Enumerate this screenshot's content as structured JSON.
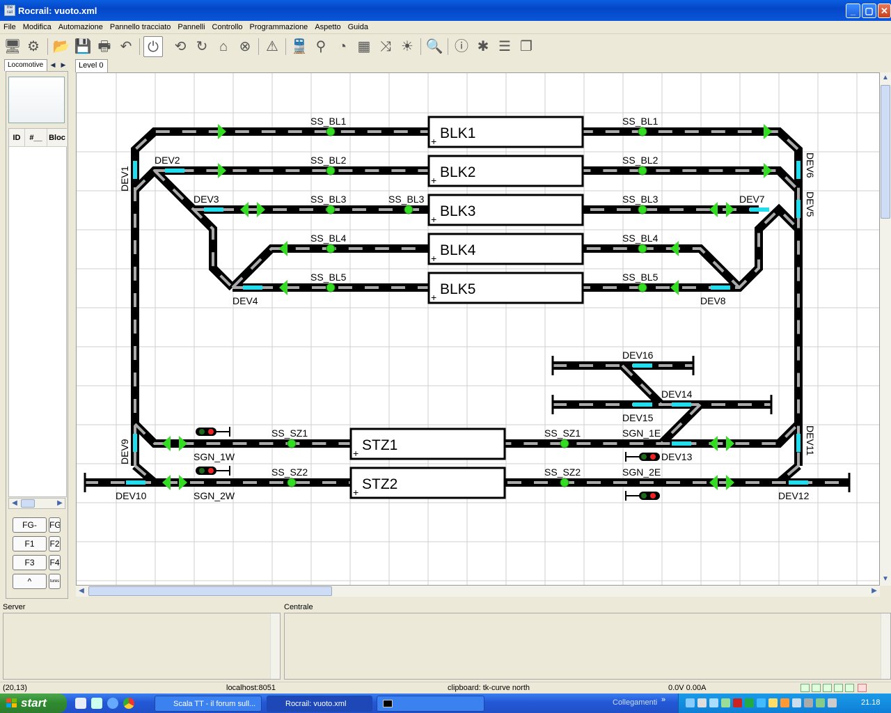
{
  "window": {
    "title": "Rocrail: vuoto.xml",
    "app_icon_text": "the rail"
  },
  "menu": [
    "File",
    "Modifica",
    "Automazione",
    "Pannello tracciato",
    "Pannelli",
    "Controllo",
    "Programmazione",
    "Aspetto",
    "Guida"
  ],
  "toolbar_icons": [
    "network-icon",
    "settings-icon",
    "open-icon",
    "save-icon",
    "print-icon",
    "undo-icon",
    "power-icon",
    "cycle-icon",
    "rotate-icon",
    "home-icon",
    "stop-icon",
    "warning-icon",
    "train-icon",
    "throttle-icon",
    "speedometer-icon",
    "grid-icon",
    "shuffle-icon",
    "light-icon",
    "zoom-icon",
    "info-icon",
    "bug-icon",
    "list-icon",
    "pages-icon"
  ],
  "left_panel": {
    "tab": "Locomotive",
    "columns": [
      "ID",
      "#__",
      "Bloc"
    ],
    "function_buttons": [
      "FG-",
      "FG+",
      "F1",
      "F2",
      "F3",
      "F4",
      "^",
      "tures"
    ]
  },
  "plan": {
    "level_tab": "Level 0",
    "blocks": [
      "BLK1",
      "BLK2",
      "BLK3",
      "BLK4",
      "BLK5",
      "STZ1",
      "STZ2"
    ],
    "block_marker": "+",
    "sensors": {
      "bl1": "SS_BL1",
      "bl2": "SS_BL2",
      "bl3": "SS_BL3",
      "bl4": "SS_BL4",
      "bl5": "SS_BL5",
      "sz1": "SS_SZ1",
      "sz2": "SS_SZ2"
    },
    "switches": [
      "DEV1",
      "DEV2",
      "DEV3",
      "DEV4",
      "DEV5",
      "DEV6",
      "DEV7",
      "DEV8",
      "DEV9",
      "DEV10",
      "DEV11",
      "DEV12",
      "DEV13",
      "DEV14",
      "DEV15",
      "DEV16"
    ],
    "signals": {
      "w1": "SGN_1W",
      "w2": "SGN_2W",
      "e1": "SGN_1E",
      "e2": "SGN_2E"
    }
  },
  "panels": {
    "server_label": "Server",
    "central_label": "Centrale"
  },
  "status": {
    "coords": "(20,13)",
    "host": "localhost:8051",
    "clipboard": "clipboard: tk-curve north",
    "power": "0.0V 0.00A"
  },
  "taskbar": {
    "start": "start",
    "tasks": [
      "Scala TT - il forum sull...",
      "Rocrail: vuoto.xml",
      ""
    ],
    "links_label": "Collegamenti",
    "clock": "21.18"
  },
  "colors": {
    "accent_green": "#33dd22",
    "switch_cyan": "#22ddee",
    "titlebar": "#0a5fe0"
  }
}
